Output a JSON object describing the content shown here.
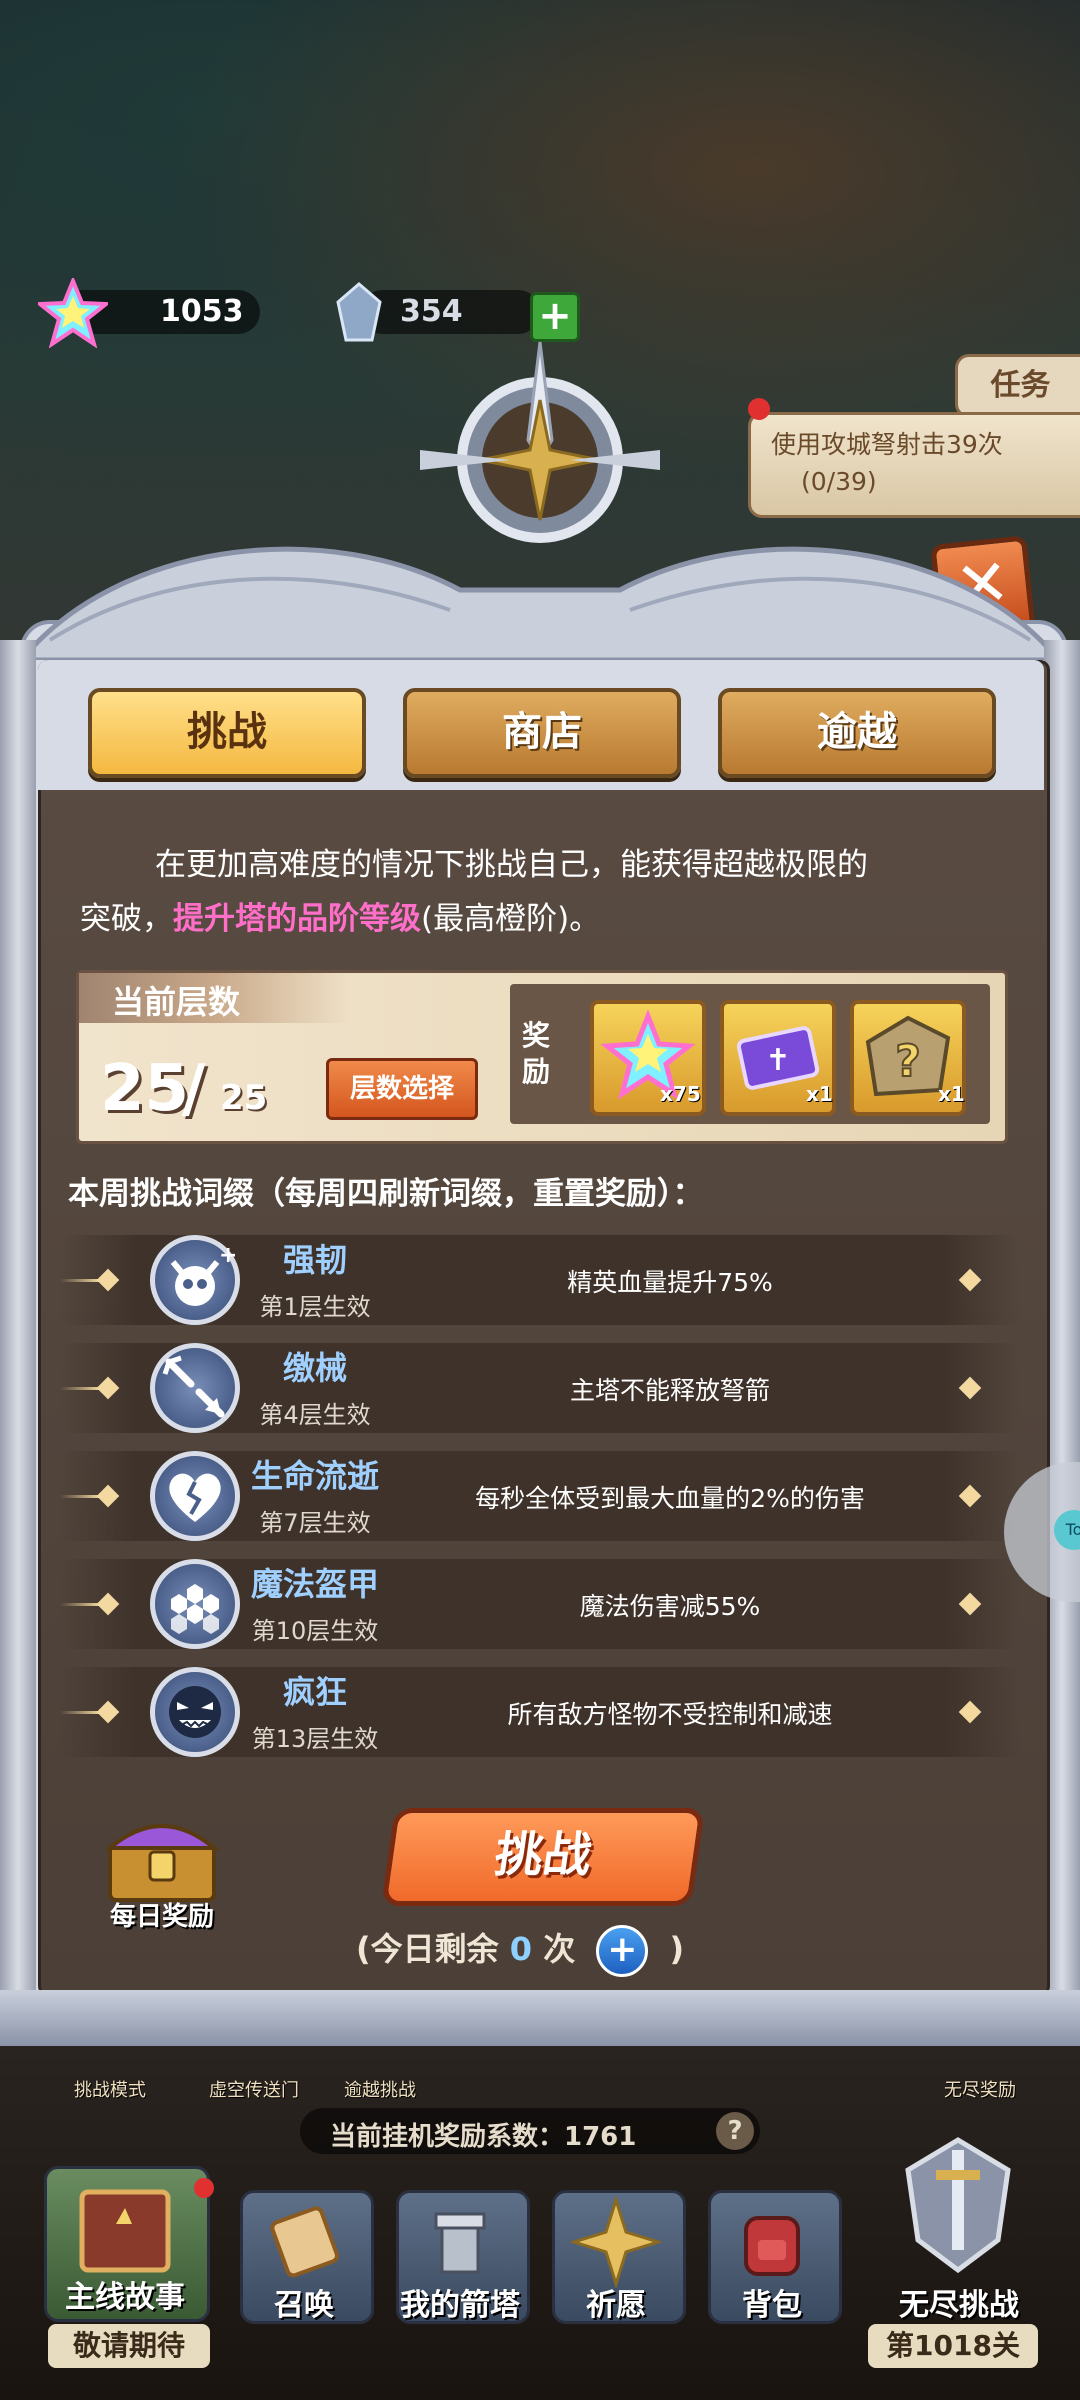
{
  "top_bar": {
    "star_value": "1053",
    "gem_value": "354"
  },
  "quest": {
    "tab_label": "任务",
    "text": "使用攻城弩射击39次",
    "progress": "(0/39)"
  },
  "tabs": [
    {
      "label": "挑战",
      "active": true
    },
    {
      "label": "商店",
      "active": false
    },
    {
      "label": "逾越",
      "active": false
    }
  ],
  "description": {
    "line1": "在更加高难度的情况下挑战自己，能获得超越极限的",
    "line2_prefix": "突破，",
    "line2_highlight": "提升塔的品阶等级",
    "line2_suffix": "(最高橙阶)。"
  },
  "floor": {
    "label": "当前层数",
    "current": "25",
    "separator": "/",
    "max": "25",
    "select_button": "层数选择",
    "reward_label": "奖励",
    "rewards": [
      {
        "icon": "rainbow-star-icon",
        "count": "x75"
      },
      {
        "icon": "purple-ticket-icon",
        "count": "x1"
      },
      {
        "icon": "mystery-box-icon",
        "count": "x1"
      }
    ]
  },
  "weekly_title": "本周挑战词缀（每周四刷新词缀，重置奖励）：",
  "modifiers": [
    {
      "name": "强韧",
      "sub": "第1层生效",
      "effect": "精英血量提升75%",
      "icon": "horned-skull-plus-icon"
    },
    {
      "name": "缴械",
      "sub": "第4层生效",
      "effect": "主塔不能释放弩箭",
      "icon": "broken-arrow-icon"
    },
    {
      "name": "生命流逝",
      "sub": "第7层生效",
      "effect": "每秒全体受到最大血量的2%的伤害",
      "icon": "broken-heart-icon"
    },
    {
      "name": "魔法盔甲",
      "sub": "第10层生效",
      "effect": "魔法伤害减55%",
      "icon": "hexagon-armor-icon"
    },
    {
      "name": "疯狂",
      "sub": "第13层生效",
      "effect": "所有敌方怪物不受控制和减速",
      "icon": "crazy-face-icon"
    }
  ],
  "daily_reward_label": "每日奖励",
  "challenge_button": "挑战",
  "remaining": {
    "prefix": "(今日剩余",
    "count": "0",
    "suffix": "次",
    "close": ")"
  },
  "bottom": {
    "small_tabs": [
      "挑战模式",
      "虚空传送门",
      "逾越挑战",
      "无尽奖励"
    ],
    "idle_reward_text": "当前挂机奖励系数：1761",
    "nav": [
      {
        "label": "主线故事",
        "sub": "敬请期待"
      },
      {
        "label": "召唤"
      },
      {
        "label": "我的箭塔"
      },
      {
        "label": "祈愿"
      },
      {
        "label": "背包"
      },
      {
        "label": "无尽挑战",
        "sub": "第1018关"
      }
    ]
  },
  "side_bubble": "To"
}
